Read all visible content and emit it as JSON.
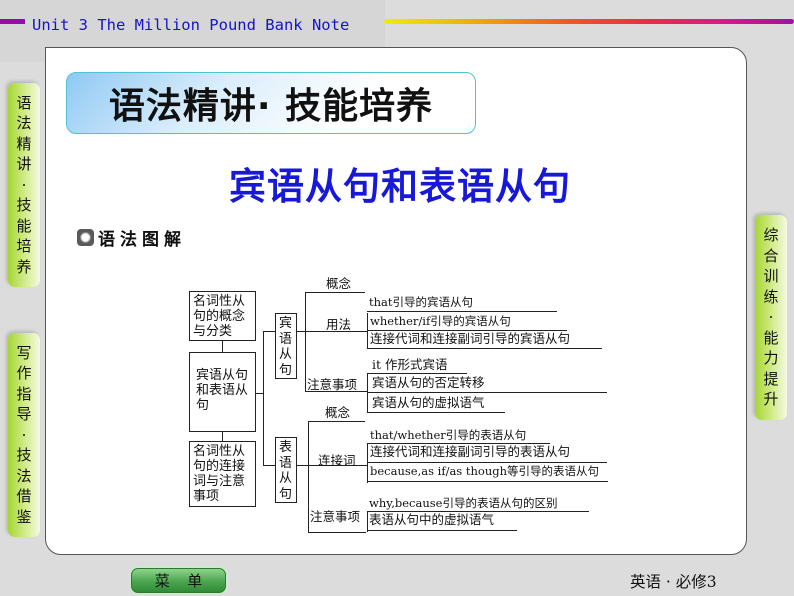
{
  "header": {
    "unit_title": "Unit 3  The Million Pound Bank Note"
  },
  "side_nav": {
    "left_top": [
      "语",
      "法",
      "精",
      "讲",
      "·",
      "技",
      "能",
      "培",
      "养"
    ],
    "left_bottom": [
      "写",
      "作",
      "指",
      "导",
      "·",
      "技",
      "法",
      "借",
      "鉴"
    ],
    "right": [
      "综",
      "合",
      "训",
      "练",
      "·",
      "能",
      "力",
      "提",
      "升"
    ]
  },
  "section_banner": "语法精讲· 技能培养",
  "main_title": "宾语从句和表语从句",
  "subheading": {
    "icon": "radio-icon",
    "text": "语法图解"
  },
  "diagram": {
    "root_boxes": {
      "concept": "名词性从句的概念与分类",
      "middle": "宾语从句和表语从句",
      "connective": "名词性从句的连接词与注意事项"
    },
    "object_clause": {
      "label": "宾语从句",
      "branches": {
        "concept": "概念",
        "usage": "用法",
        "notes": "注意事项"
      },
      "usage_items": [
        "that引导的宾语从句",
        "whether/if引导的宾语从句",
        "连接代词和连接副词引导的宾语从句"
      ],
      "notes_items": [
        "it 作形式宾语",
        "宾语从句的否定转移",
        "宾语从句的虚拟语气"
      ]
    },
    "predicative_clause": {
      "label": "表语从句",
      "branches": {
        "concept": "概念",
        "connectives": "连接词",
        "notes": "注意事项"
      },
      "connective_items": [
        "that/whether引导的表语从句",
        "连接代词和连接副词引导的表语从句",
        "because,as if/as though等引导的表语从句"
      ],
      "notes_items": [
        "why,because引导的表语从句的区别",
        "表语从句中的虚拟语气"
      ]
    }
  },
  "footer": {
    "menu_button": [
      "菜",
      "单"
    ],
    "book_label": "英语 · 必修3"
  }
}
